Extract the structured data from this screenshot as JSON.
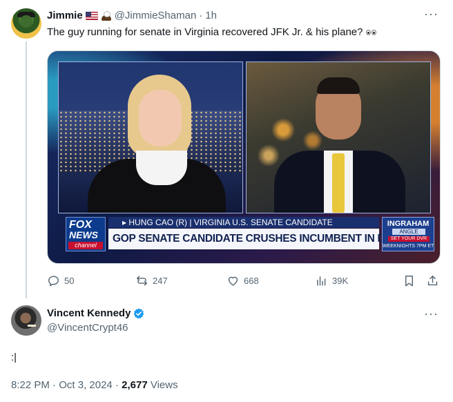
{
  "tweet1": {
    "name": "Jimmie",
    "handle": "@JimmieShaman",
    "separator": "·",
    "time": "1h",
    "text": "The guy running for senate in Virginia recovered JFK Jr. & his plane?",
    "more": "···",
    "icons": {
      "name_emojis": [
        "us-flag-icon",
        "eagle-icon"
      ],
      "text_emoji": "eyes-icon"
    },
    "media": {
      "chyron_top": "▸ HUNG CAO (R) | VIRGINIA U.S. SENATE CANDIDATE",
      "chyron_main": "GOP SENATE CANDIDATE CRUSHES INCUMBENT IN DEBATE",
      "network_logo": {
        "line1": "FOX",
        "line2": "NEWS",
        "line3": "channel"
      },
      "show_logo": {
        "line1": "INGRAHAM",
        "line2": "ANGLE",
        "line3": "SET YOUR DVR",
        "line4": "WEEKNIGHTS 7PM ET"
      }
    },
    "actions": {
      "replies": "50",
      "reposts": "247",
      "likes": "668",
      "views": "39K"
    }
  },
  "tweet2": {
    "name": "Vincent Kennedy",
    "handle": "@VincentCrypt46",
    "text": ":|",
    "time": "8:22 PM",
    "separator": "·",
    "date": "Oct 3, 2024",
    "views_count": "2,677",
    "views_label": "Views",
    "more": "···"
  },
  "colors": {
    "text": "#0f1419",
    "secondary": "#536471",
    "verified": "#1d9bf0",
    "divider": "#cfd9de"
  }
}
